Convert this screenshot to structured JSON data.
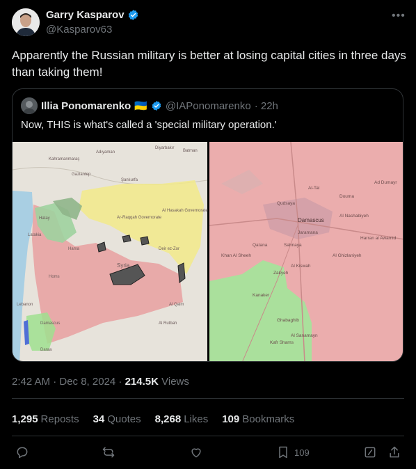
{
  "author": {
    "name": "Garry Kasparov",
    "handle": "@Kasparov63"
  },
  "tweet_text": "Apparently the Russian military is better at losing capital cities in three days than taking them!",
  "quoted": {
    "name": "Illia Ponomarenko",
    "flag": "🇺🇦",
    "handle": "@IAPonomarenko",
    "time": "· 22h",
    "text": "Now, THIS is what's called a 'special military operation.'"
  },
  "map_labels": {
    "left": [
      "Diyarbakır",
      "Batman",
      "Kahramanmaraş",
      "Adıyaman",
      "Gaziantep",
      "Şanlıurfa",
      "Hatay",
      "Latakia",
      "Hama",
      "Homs",
      "Syria",
      "Damascus",
      "Al Hasakah Governorate",
      "Deir ez-Zor",
      "Ar-Raqqah Governorate",
      "Al Qaim",
      "Al Rutbah",
      "Lebanon",
      "Daraa"
    ],
    "right": [
      "Al-Tal",
      "Damascus",
      "Jaramana",
      "Sahnaya",
      "Qatana",
      "Al Kiswah",
      "Zakyeh",
      "Kanaker",
      "Ghabaghib",
      "Kafr Shams",
      "Al Sanamayn",
      "Harran al Awamid",
      "Ad Dumayr",
      "Douma",
      "Al Nashabiyeh",
      "Qudsaya",
      "Al Ghizlaniyeh",
      "Khan Al Sheeh"
    ]
  },
  "timestamp": "2:42 AM · Dec 8, 2024 ·",
  "views_count": "214.5K",
  "views_label": "Views",
  "stats": {
    "reposts_count": "1,295",
    "reposts_label": "Reposts",
    "quotes_count": "34",
    "quotes_label": "Quotes",
    "likes_count": "8,268",
    "likes_label": "Likes",
    "bookmarks_count": "109",
    "bookmarks_label": "Bookmarks"
  },
  "actions": {
    "bookmark_count": "109"
  },
  "icons": [
    "avatar",
    "verified-badge-icon",
    "more-icon",
    "reply-icon",
    "repost-icon",
    "like-icon",
    "bookmark-icon",
    "grok-icon",
    "share-icon"
  ],
  "colors": {
    "verified": "#1d9bf0",
    "regime_red": "#e8a0a0",
    "opposition_green": "#9fe08f",
    "sdf_yellow": "#f2ea8a"
  }
}
